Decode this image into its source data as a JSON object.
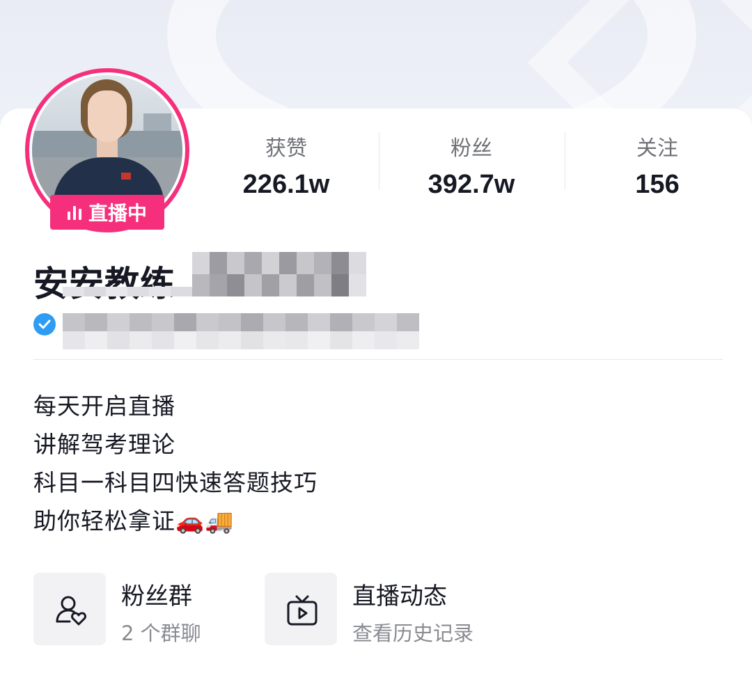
{
  "theme": {
    "accent": "#f52f7c",
    "verify": "#2c9cf5"
  },
  "profile": {
    "live_label": "直播中",
    "name": "安安教练",
    "verified": true,
    "stats": [
      {
        "label": "获赞",
        "value": "226.1w"
      },
      {
        "label": "粉丝",
        "value": "392.7w"
      },
      {
        "label": "关注",
        "value": "156"
      }
    ],
    "bio": [
      "每天开启直播",
      "讲解驾考理论",
      "科目一科目四快速答题技巧",
      "助你轻松拿证🚗🚚"
    ]
  },
  "entries": [
    {
      "title": "粉丝群",
      "subtitle": "2 个群聊",
      "icon": "fan-group-icon"
    },
    {
      "title": "直播动态",
      "subtitle": "查看历史记录",
      "icon": "live-replay-icon"
    }
  ]
}
